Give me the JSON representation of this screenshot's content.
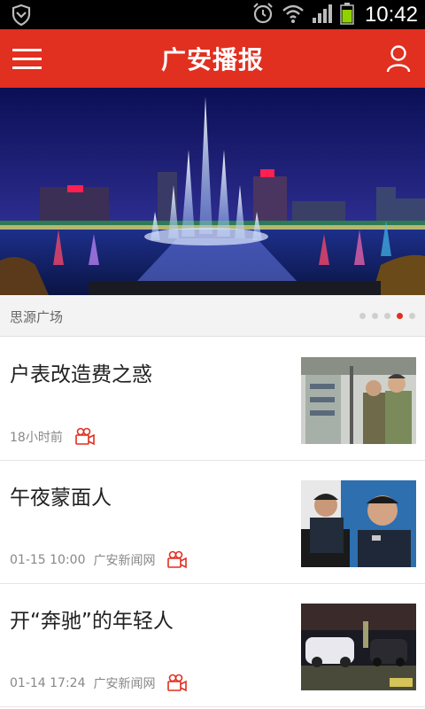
{
  "status_bar": {
    "time": "10:42",
    "icons": [
      "shield-icon",
      "alarm-icon",
      "wifi-icon",
      "signal-icon",
      "battery-icon"
    ]
  },
  "app_bar": {
    "title": "广安播报",
    "left_icon": "menu-icon",
    "right_icon": "user-icon",
    "background": "#e12f20"
  },
  "banner": {
    "caption": "思源广场",
    "slide_count": 5,
    "active_slide": 4
  },
  "news": [
    {
      "title": "户表改造费之惑",
      "time": "18小时前",
      "source": "",
      "has_video": true
    },
    {
      "title": "午夜蒙面人",
      "time": "01-15 10:00",
      "source": "广安新闻网",
      "has_video": true
    },
    {
      "title": "开“奔驰”的年轻人",
      "time": "01-14 17:24",
      "source": "广安新闻网",
      "has_video": true
    }
  ],
  "colors": {
    "accent": "#e12f20",
    "text": "#222222",
    "meta": "#888888"
  }
}
